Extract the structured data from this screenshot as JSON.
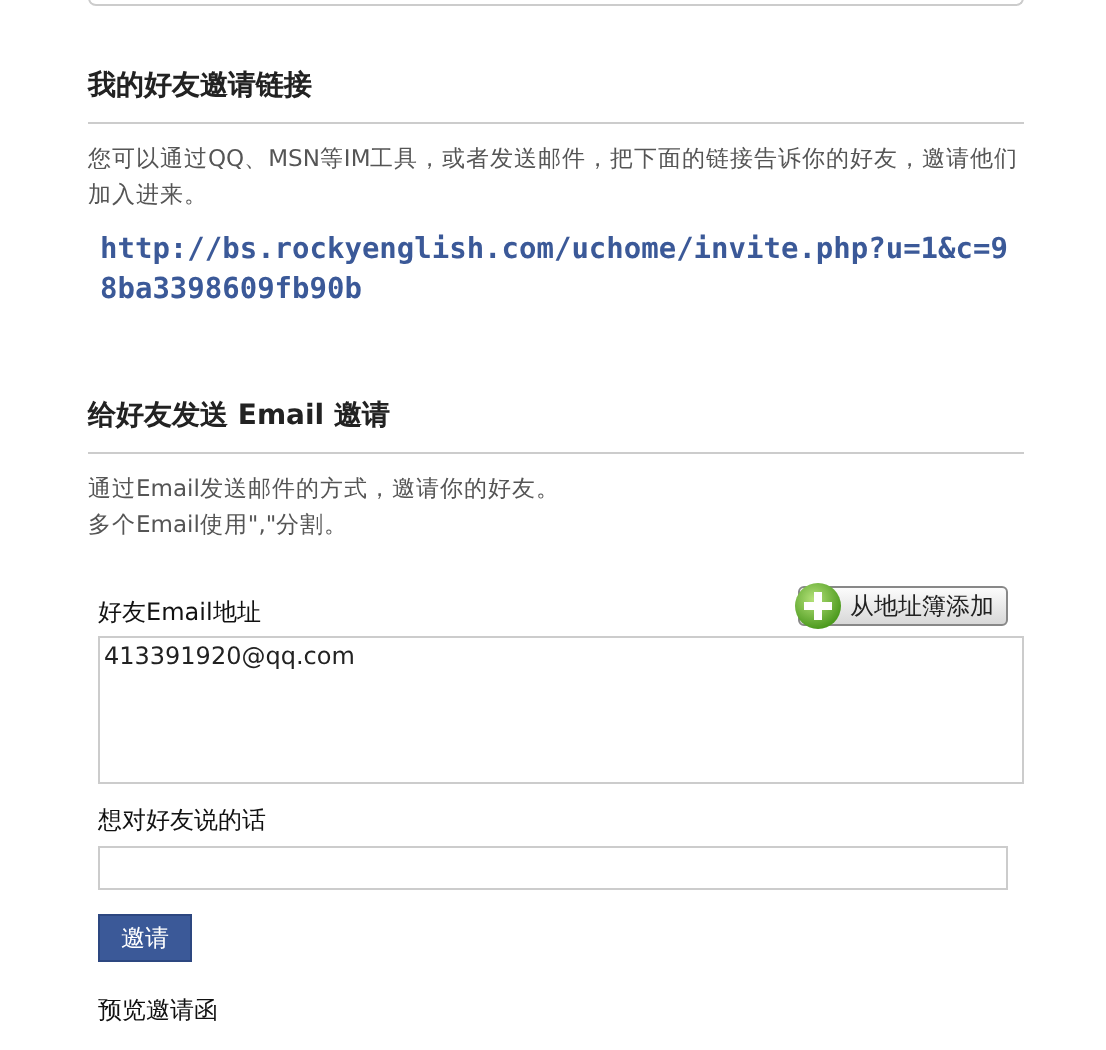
{
  "invite_link_section": {
    "title": "我的好友邀请链接",
    "description": "您可以通过QQ、MSN等IM工具，或者发送邮件，把下面的链接告诉你的好友，邀请他们加入进来。",
    "link": "http://bs.rockyenglish.com/uchome/invite.php?u=1&c=98ba3398609fb90b"
  },
  "email_section": {
    "title": "给好友发送  Email 邀请",
    "description_lines": [
      "通过Email发送邮件的方式，邀请你的好友。",
      "多个Email使用\",\"分割。"
    ],
    "email_field": {
      "label": "好友Email地址",
      "value": "413391920@qq.com"
    },
    "address_book_button": "从地址簿添加",
    "message_field": {
      "label": "想对好友说的话"
    },
    "submit_button": "邀请",
    "preview_label": "预览邀请函"
  }
}
